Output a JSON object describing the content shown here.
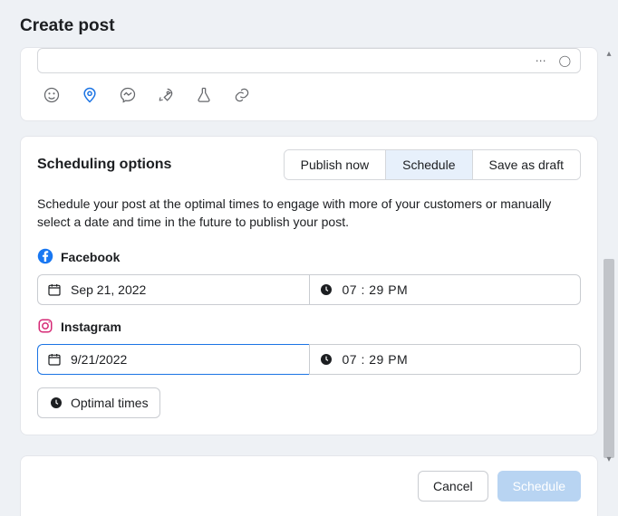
{
  "header": {
    "title": "Create post"
  },
  "composer": {
    "right_hint_1": "⋯",
    "right_hint_2": "◯"
  },
  "scheduling": {
    "title": "Scheduling options",
    "tabs": {
      "publish_now": "Publish now",
      "schedule": "Schedule",
      "save_draft": "Save as draft"
    },
    "help": "Schedule your post at the optimal times to engage with more of your customers or manually select a date and time in the future to publish your post.",
    "facebook": {
      "label": "Facebook",
      "date": "Sep 21, 2022",
      "time": "07 : 29 PM"
    },
    "instagram": {
      "label": "Instagram",
      "date": "9/21/2022",
      "time": "07 : 29 PM"
    },
    "optimal_label": "Optimal times"
  },
  "footer": {
    "cancel": "Cancel",
    "schedule": "Schedule"
  }
}
